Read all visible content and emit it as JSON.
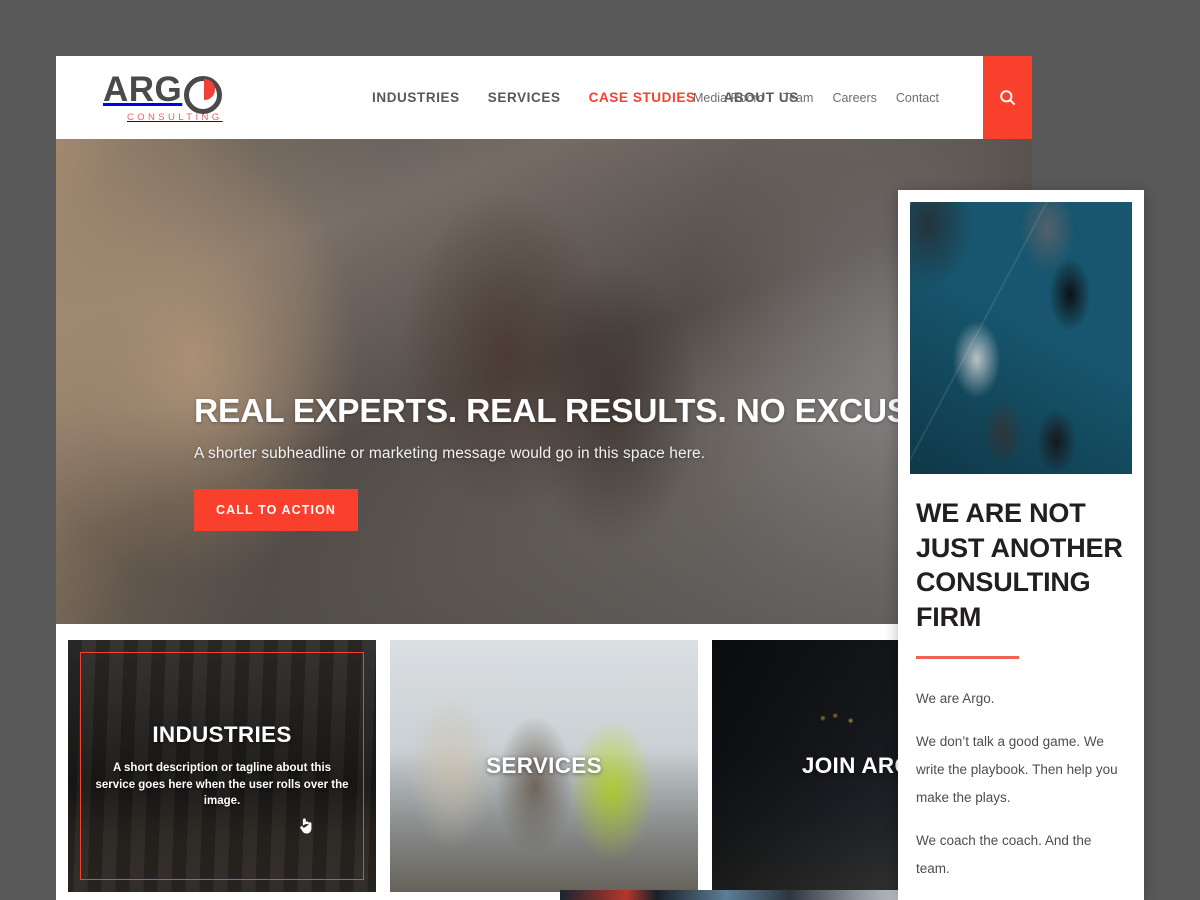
{
  "brand": {
    "name": "ARGO",
    "name_prefix": "ARG",
    "tagline": "CONSULTING",
    "accent_color": "#f8402c",
    "logo_gray": "#4a4a4a"
  },
  "header": {
    "main_nav": [
      {
        "label": "INDUSTRIES",
        "active": false
      },
      {
        "label": "SERVICES",
        "active": false
      },
      {
        "label": "CASE STUDIES",
        "active": true
      },
      {
        "label": "ABOUT US",
        "active": false
      }
    ],
    "util_nav": [
      {
        "label": "Media Room"
      },
      {
        "label": "Team"
      },
      {
        "label": "Careers"
      },
      {
        "label": "Contact"
      }
    ],
    "search": {
      "icon": "search-icon",
      "background": "#f8402c"
    }
  },
  "hero": {
    "title": "REAL EXPERTS. REAL RESULTS. NO EXCUSES.",
    "subtitle": "A shorter subheadline or marketing message would go in this space here.",
    "cta_label": "CALL TO ACTION",
    "cta_color": "#f8402c"
  },
  "cards": [
    {
      "title": "INDUSTRIES",
      "description": "A short description or tagline about this service goes here when the user rolls over the image.",
      "hovered": true,
      "hover_border_color": "#f8402c"
    },
    {
      "title": "SERVICES",
      "description": "",
      "hovered": false,
      "hover_border_color": "#f8402c"
    },
    {
      "title": "JOIN ARGO",
      "description": "",
      "hovered": false,
      "hover_border_color": "#f8402c"
    }
  ],
  "panel": {
    "image_alt": "overhead-view-of-business-people-walking",
    "title": "WE ARE NOT JUST ANOTHER CONSULTING FIRM",
    "rule_color": "#f16154",
    "paragraphs": [
      "We are Argo.",
      "We don’t talk a good game. We write the playbook. Then help you make the plays.",
      "We coach the coach. And the team."
    ]
  },
  "cursors": [
    {
      "name": "nav-cursor",
      "target": "CASE STUDIES",
      "style": "pointing-hand-dark"
    },
    {
      "name": "card-cursor",
      "target": "INDUSTRIES",
      "style": "pointing-hand-light"
    }
  ],
  "canvas": {
    "backdrop_color": "#595959"
  }
}
